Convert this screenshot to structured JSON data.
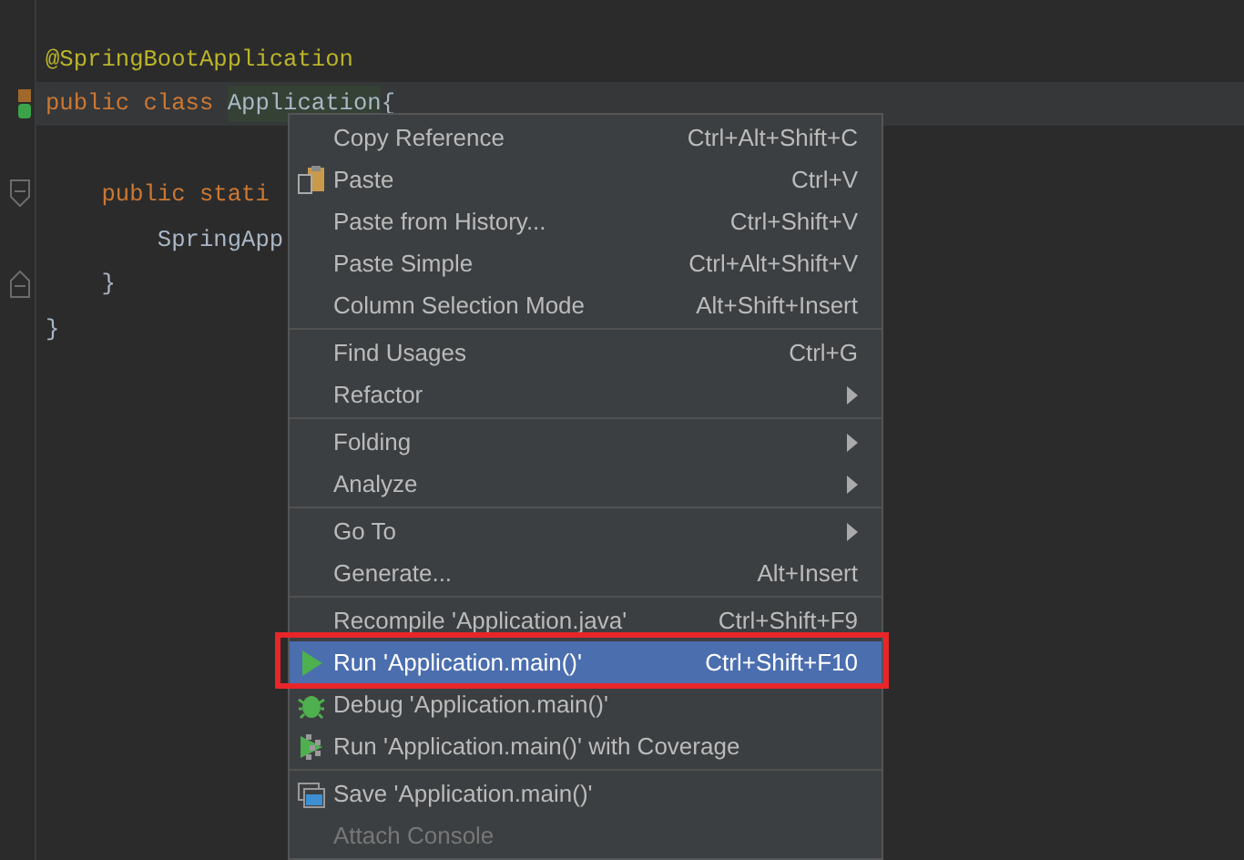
{
  "editor": {
    "lines": [
      {
        "kind": "code",
        "segments": [
          {
            "kind": "annotation",
            "text": "@SpringBootApplication"
          }
        ]
      },
      {
        "kind": "code",
        "current": true,
        "marker": {
          "kind": "run"
        },
        "segments": [
          {
            "kind": "keyword",
            "text": "public class "
          },
          {
            "kind": "usage",
            "text": "Application"
          },
          {
            "kind": "plain",
            "text": "{"
          }
        ]
      },
      {
        "kind": "blank"
      },
      {
        "kind": "code",
        "marker": {
          "kind": "fold-start"
        },
        "segments": [
          {
            "kind": "keyword",
            "text": "    public stati"
          }
        ]
      },
      {
        "kind": "code",
        "segments": [
          {
            "kind": "plain",
            "text": "        SpringApp"
          }
        ]
      },
      {
        "kind": "code",
        "marker": {
          "kind": "fold-end"
        },
        "segments": [
          {
            "kind": "plain",
            "text": "    }"
          }
        ]
      },
      {
        "kind": "code",
        "segments": [
          {
            "kind": "plain",
            "text": "}"
          }
        ]
      }
    ]
  },
  "context_menu": {
    "groups": [
      [
        {
          "kind": "plain",
          "label": "Copy Reference",
          "shortcut": "Ctrl+Alt+Shift+C",
          "submenu": false,
          "selected": false,
          "disabled": false,
          "annotated": false
        },
        {
          "kind": "paste",
          "label": "Paste",
          "shortcut": "Ctrl+V",
          "submenu": false,
          "selected": false,
          "disabled": false,
          "annotated": false
        },
        {
          "kind": "plain",
          "label": "Paste from History...",
          "shortcut": "Ctrl+Shift+V",
          "submenu": false,
          "selected": false,
          "disabled": false,
          "annotated": false
        },
        {
          "kind": "plain",
          "label": "Paste Simple",
          "shortcut": "Ctrl+Alt+Shift+V",
          "submenu": false,
          "selected": false,
          "disabled": false,
          "annotated": false
        },
        {
          "kind": "plain",
          "label": "Column Selection Mode",
          "shortcut": "Alt+Shift+Insert",
          "submenu": false,
          "selected": false,
          "disabled": false,
          "annotated": false
        }
      ],
      [
        {
          "kind": "plain",
          "label": "Find Usages",
          "shortcut": "Ctrl+G",
          "submenu": false,
          "selected": false,
          "disabled": false,
          "annotated": false
        },
        {
          "kind": "plain",
          "label": "Refactor",
          "submenu": true,
          "selected": false,
          "disabled": false,
          "annotated": false
        }
      ],
      [
        {
          "kind": "plain",
          "label": "Folding",
          "submenu": true,
          "selected": false,
          "disabled": false,
          "annotated": false
        },
        {
          "kind": "plain",
          "label": "Analyze",
          "submenu": true,
          "selected": false,
          "disabled": false,
          "annotated": false
        }
      ],
      [
        {
          "kind": "plain",
          "label": "Go To",
          "submenu": true,
          "selected": false,
          "disabled": false,
          "annotated": false
        },
        {
          "kind": "plain",
          "label": "Generate...",
          "shortcut": "Alt+Insert",
          "submenu": false,
          "selected": false,
          "disabled": false,
          "annotated": false
        }
      ],
      [
        {
          "kind": "plain",
          "label": "Recompile 'Application.java'",
          "shortcut": "Ctrl+Shift+F9",
          "submenu": false,
          "selected": false,
          "disabled": false,
          "annotated": false
        },
        {
          "kind": "run",
          "label": "Run 'Application.main()'",
          "shortcut": "Ctrl+Shift+F10",
          "submenu": false,
          "selected": true,
          "disabled": false,
          "annotated": true
        },
        {
          "kind": "debug",
          "label": "Debug 'Application.main()'",
          "submenu": false,
          "selected": false,
          "disabled": false,
          "annotated": false
        },
        {
          "kind": "coverage",
          "label": "Run 'Application.main()' with Coverage",
          "submenu": false,
          "selected": false,
          "disabled": false,
          "annotated": false
        }
      ],
      [
        {
          "kind": "save",
          "label": "Save 'Application.main()'",
          "submenu": false,
          "selected": false,
          "disabled": false,
          "annotated": false
        },
        {
          "kind": "plain",
          "label": "Attach Console",
          "submenu": false,
          "selected": false,
          "disabled": true,
          "annotated": false
        }
      ]
    ]
  }
}
